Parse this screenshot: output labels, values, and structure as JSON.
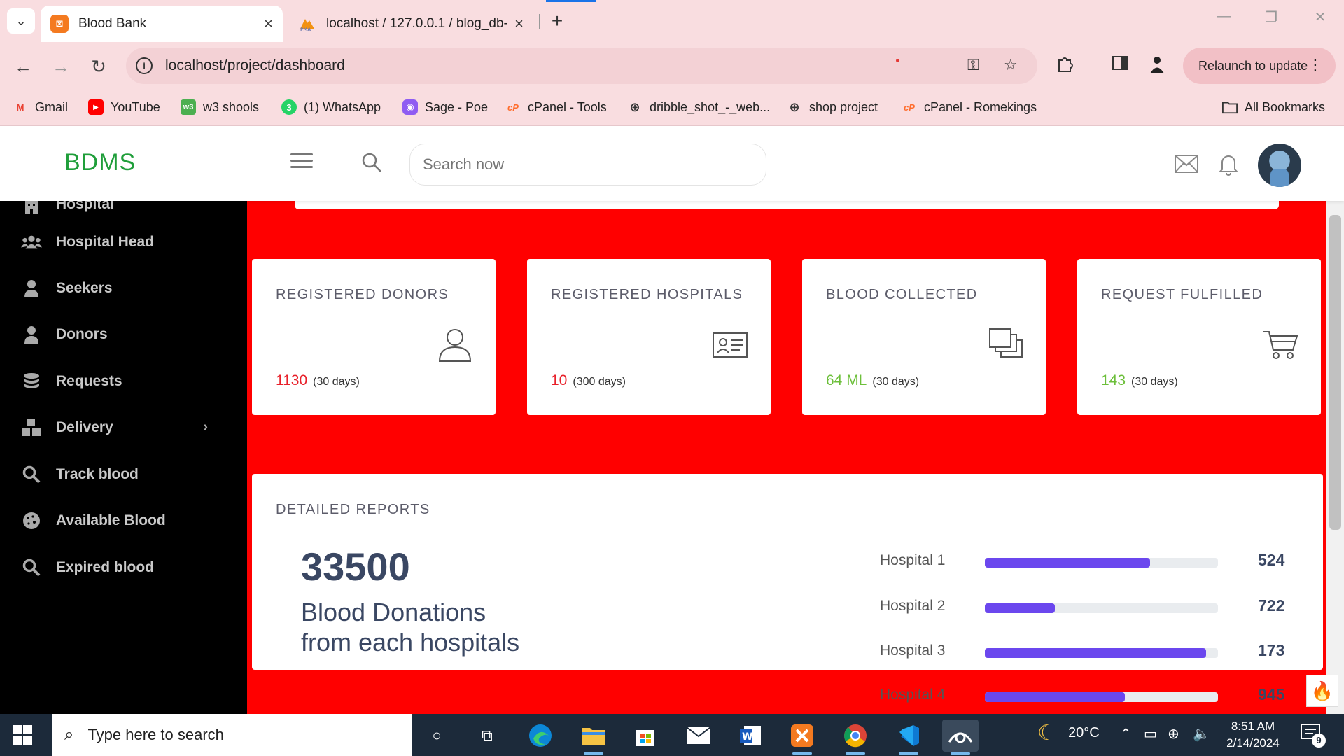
{
  "browser": {
    "tabs": [
      {
        "title": "Blood Bank",
        "active": true,
        "favicon": "xampp-icon"
      },
      {
        "title": "localhost / 127.0.0.1 / blog_db-",
        "active": false,
        "favicon": "phpmyadmin-icon"
      }
    ],
    "url": "localhost/project/dashboard",
    "relaunch_label": "Relaunch to update",
    "bookmarks": [
      {
        "label": "Gmail",
        "icon": "gmail-icon"
      },
      {
        "label": "YouTube",
        "icon": "youtube-icon"
      },
      {
        "label": "w3 shools",
        "icon": "w3schools-icon"
      },
      {
        "label": "(1) WhatsApp",
        "icon": "whatsapp-icon"
      },
      {
        "label": "Sage - Poe",
        "icon": "poe-icon"
      },
      {
        "label": "cPanel - Tools",
        "icon": "cpanel-icon"
      },
      {
        "label": "dribble_shot_-_web...",
        "icon": "globe-icon"
      },
      {
        "label": "shop project",
        "icon": "globe-icon"
      },
      {
        "label": "cPanel - Romekings",
        "icon": "cpanel-icon"
      }
    ],
    "all_bookmarks_label": "All Bookmarks"
  },
  "app": {
    "brand": "BDMS",
    "search_placeholder": "Search now",
    "colors": {
      "brand": "#1f9e3a",
      "background": "#ff0000",
      "accent": "#e8202a",
      "bar": "#6b47ee"
    }
  },
  "sidebar": {
    "items": [
      {
        "label": "Hospital",
        "icon": "building-icon"
      },
      {
        "label": "Hospital Head",
        "icon": "users-icon"
      },
      {
        "label": "Seekers",
        "icon": "user-icon"
      },
      {
        "label": "Donors",
        "icon": "user-icon"
      },
      {
        "label": "Requests",
        "icon": "database-icon"
      },
      {
        "label": "Delivery",
        "icon": "boxes-icon",
        "has_submenu": true
      },
      {
        "label": "Track blood",
        "icon": "search-icon"
      },
      {
        "label": "Available Blood",
        "icon": "cookie-icon"
      },
      {
        "label": "Expired blood",
        "icon": "search-icon"
      }
    ]
  },
  "stats": [
    {
      "label": "REGISTERED DONORS",
      "value": "1130",
      "period": "(30 days)",
      "icon": "user-outline-icon",
      "value_color": "red"
    },
    {
      "label": "REGISTERED HOSPITALS",
      "value": "10",
      "period": "(300 days)",
      "icon": "id-card-icon",
      "value_color": "red"
    },
    {
      "label": "BLOOD COLLECTED",
      "value": "64 ML",
      "period": "(30 days)",
      "icon": "copy-icon",
      "value_color": "green"
    },
    {
      "label": "REQUEST FULFILLED",
      "value": "143",
      "period": "(30 days)",
      "icon": "cart-icon",
      "value_color": "green"
    }
  ],
  "reports": {
    "label": "DETAILED REPORTS",
    "total": "33500",
    "subtitle": "Blood Donations from each hospitals",
    "hospitals": [
      {
        "name": "Hospital 1",
        "value": "524",
        "progress": 0.71
      },
      {
        "name": "Hospital 2",
        "value": "722",
        "progress": 0.3
      },
      {
        "name": "Hospital 3",
        "value": "173",
        "progress": 0.95
      },
      {
        "name": "Hospital 4",
        "value": "945",
        "progress": 0.6
      }
    ]
  },
  "taskbar": {
    "search_placeholder": "Type here to search",
    "weather": "20°C",
    "time": "8:51 AM",
    "date": "2/14/2024",
    "notifications": "9"
  }
}
